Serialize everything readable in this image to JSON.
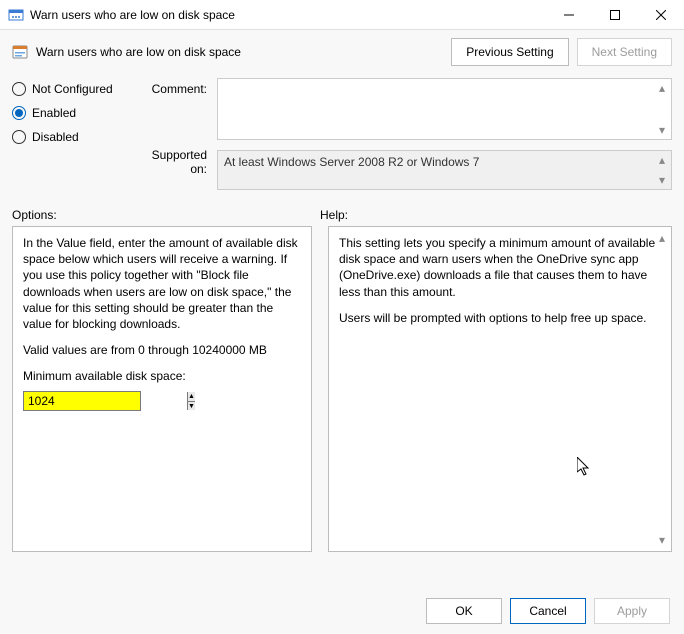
{
  "window": {
    "title": "Warn users who are low on disk space"
  },
  "header": {
    "title": "Warn users who are low on disk space",
    "prev_btn": "Previous Setting",
    "next_btn": "Next Setting"
  },
  "radios": {
    "not_configured": "Not Configured",
    "enabled": "Enabled",
    "disabled": "Disabled",
    "selected": "enabled"
  },
  "labels": {
    "comment": "Comment:",
    "supported": "Supported on:",
    "options": "Options:",
    "help": "Help:"
  },
  "supported_text": "At least Windows Server 2008 R2 or Windows 7",
  "options_panel": {
    "para1": "In the Value field, enter the amount of available disk space below which users will receive a warning. If you use this policy together with \"Block file downloads when users are low on disk space,\" the value for this setting should be greater than the value for blocking downloads.",
    "para2": "Valid values are from 0 through 10240000 MB",
    "spin_label": "Minimum available disk space:",
    "spin_value": "1024"
  },
  "help_panel": {
    "para1": "This setting lets you specify a minimum amount of available disk space and warn users when the OneDrive sync app (OneDrive.exe) downloads a file that causes them to have less than this amount.",
    "para2": "Users will be prompted with options to help free up space."
  },
  "buttons": {
    "ok": "OK",
    "cancel": "Cancel",
    "apply": "Apply"
  }
}
